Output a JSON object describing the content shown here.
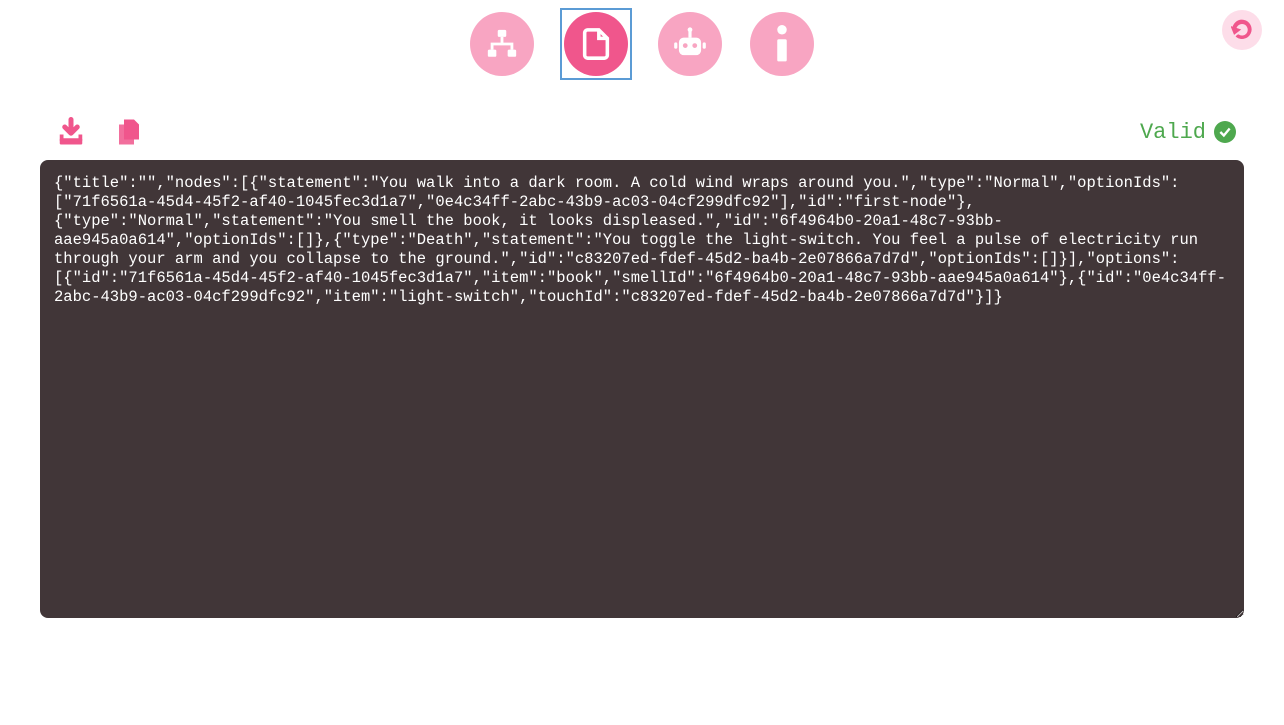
{
  "nav": {
    "buttons": [
      {
        "name": "tree-view",
        "active": false
      },
      {
        "name": "document-view",
        "active": true
      },
      {
        "name": "robot-view",
        "active": false
      },
      {
        "name": "info-view",
        "active": false
      }
    ]
  },
  "toolbar": {
    "actions": [
      {
        "name": "download"
      },
      {
        "name": "copy"
      }
    ]
  },
  "status": {
    "label": "Valid"
  },
  "editor": {
    "content": "{\"title\":\"\",\"nodes\":[{\"statement\":\"You walk into a dark room. A cold wind wraps around you.\",\"type\":\"Normal\",\"optionIds\":[\"71f6561a-45d4-45f2-af40-1045fec3d1a7\",\"0e4c34ff-2abc-43b9-ac03-04cf299dfc92\"],\"id\":\"first-node\"},{\"type\":\"Normal\",\"statement\":\"You smell the book, it looks displeased.\",\"id\":\"6f4964b0-20a1-48c7-93bb-aae945a0a614\",\"optionIds\":[]},{\"type\":\"Death\",\"statement\":\"You toggle the light-switch. You feel a pulse of electricity run through your arm and you collapse to the ground.\",\"id\":\"c83207ed-fdef-45d2-ba4b-2e07866a7d7d\",\"optionIds\":[]}],\"options\":[{\"id\":\"71f6561a-45d4-45f2-af40-1045fec3d1a7\",\"item\":\"book\",\"smellId\":\"6f4964b0-20a1-48c7-93bb-aae945a0a614\"},{\"id\":\"0e4c34ff-2abc-43b9-ac03-04cf299dfc92\",\"item\":\"light-switch\",\"touchId\":\"c83207ed-fdef-45d2-ba4b-2e07866a7d7d\"}]}"
  }
}
